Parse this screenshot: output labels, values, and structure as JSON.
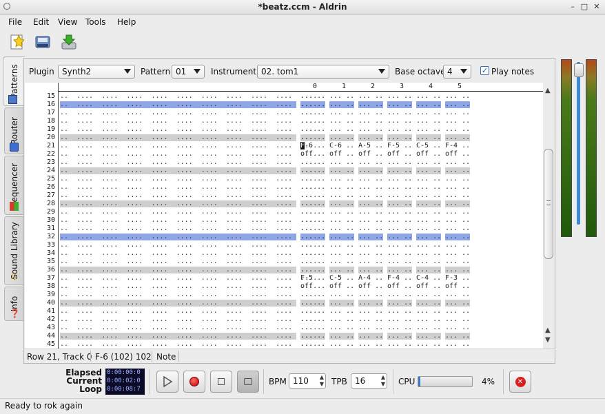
{
  "window": {
    "title": "*beatz.ccm - Aldrin",
    "controls": [
      "–",
      "□",
      "✕"
    ]
  },
  "menu": [
    "File",
    "Edit",
    "View",
    "Tools",
    "Help"
  ],
  "toolbar": [
    "new-file-icon",
    "save-icon",
    "import-icon"
  ],
  "tabs": [
    "Patterns",
    "Router",
    "Sequencer",
    "Sound Library",
    "Info"
  ],
  "controls": {
    "plugin_label": "Plugin",
    "plugin_value": "Synth2",
    "pattern_label": "Pattern",
    "pattern_value": "01",
    "instrument_label": "Instrument",
    "instrument_value": "02. tom1",
    "octave_label": "Base octave",
    "octave_value": "4",
    "play_notes_label": "Play notes",
    "play_notes_checked": true
  },
  "grid": {
    "columns": [
      "0",
      "1",
      "2",
      "3",
      "4",
      "5"
    ],
    "rows": [
      "15",
      "16",
      "17",
      "18",
      "19",
      "20",
      "21",
      "22",
      "23",
      "24",
      "25",
      "26",
      "27",
      "28",
      "29",
      "30",
      "31",
      "32",
      "33",
      "34",
      "35",
      "36",
      "37",
      "38",
      "39",
      "40",
      "41",
      "42",
      "43",
      "44",
      "45"
    ],
    "notes": {
      "21": [
        "F-6",
        "C-6",
        "A-5",
        "F-5",
        "C-5",
        "F-4"
      ],
      "22": [
        "off",
        "off",
        "off",
        "off",
        "off",
        "off"
      ],
      "37": [
        "F-5",
        "C-5",
        "A-4",
        "F-4",
        "C-4",
        "F-3"
      ],
      "38": [
        "off",
        "off",
        "off",
        "off",
        "off",
        "off"
      ]
    },
    "empty_cell": "...",
    "cursor_row": "21",
    "highlight_color": "#8fa6e8",
    "beat_color": "#cfcfcf"
  },
  "status_row": {
    "position": "Row 21, Track 0",
    "value": "F-6 (102) 102",
    "column": "Note"
  },
  "transport": {
    "labels": [
      "Elapsed",
      "Current",
      "Loop"
    ],
    "times": [
      "0:00:00:0",
      "0:00:02:0",
      "0:00:08:7"
    ],
    "bpm_label": "BPM",
    "bpm": "110",
    "tpb_label": "TPB",
    "tpb": "16",
    "cpu_label": "CPU",
    "cpu": "4%",
    "cpu_level": 0.04
  },
  "statusbar": "Ready to rok again"
}
